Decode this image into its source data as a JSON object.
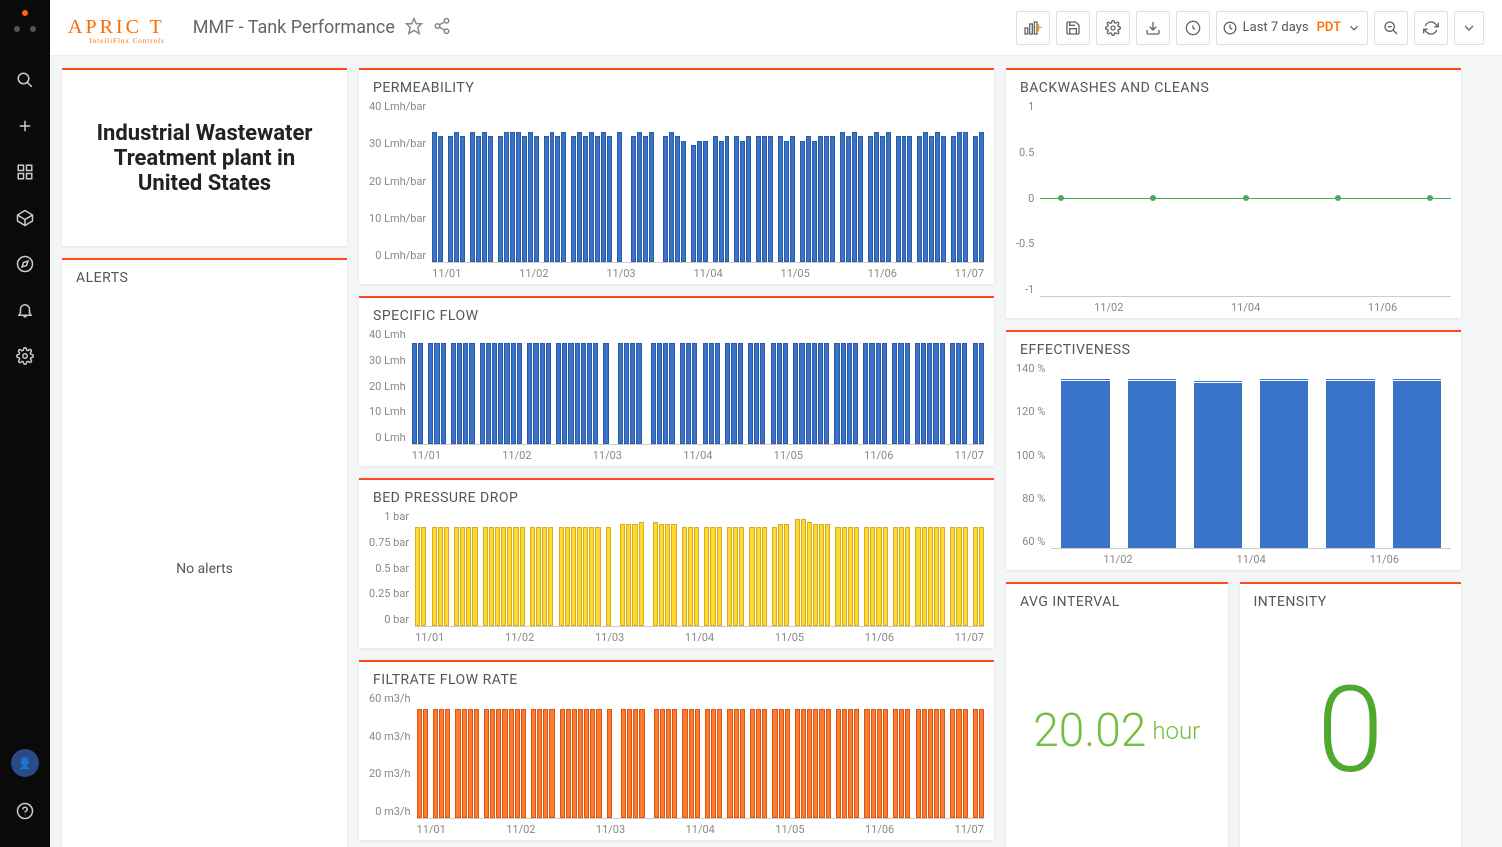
{
  "brand": {
    "name": "APRIC  T",
    "sub": "IntelliFlux Controls"
  },
  "page_title": "MMF - Tank Performance",
  "time_picker": {
    "label": "Last 7 days",
    "tz": "PDT"
  },
  "headline": "Industrial Wastewater Treatment plant in United States",
  "alerts": {
    "title": "ALERTS",
    "empty_text": "No alerts"
  },
  "avg_interval": {
    "title": "AVG INTERVAL",
    "value": "20.02",
    "unit": "hour"
  },
  "intensity": {
    "title": "INTENSITY",
    "value": "0"
  },
  "chart_data": [
    {
      "id": "permeability",
      "title": "PERMEABILITY",
      "type": "bar",
      "ylim": [
        0,
        40
      ],
      "yunit": "Lmh/bar",
      "yticks": [
        0,
        10,
        20,
        30,
        40
      ],
      "color": "blue",
      "categories": [
        "11/01",
        "11/02",
        "11/03",
        "11/04",
        "11/05",
        "11/06",
        "11/07"
      ],
      "values": [
        32,
        31,
        0,
        31,
        32,
        31,
        0,
        32,
        31,
        32,
        31,
        0,
        31,
        32,
        32,
        32,
        31,
        32,
        31,
        0,
        31,
        32,
        31,
        32,
        0,
        31,
        32,
        31,
        32,
        31,
        32,
        31,
        0,
        32,
        0,
        0,
        31,
        32,
        31,
        32,
        0,
        0,
        31,
        32,
        31,
        30,
        0,
        29,
        30,
        30,
        0,
        31,
        30,
        31,
        0,
        31,
        30,
        31,
        0,
        31,
        31,
        31,
        0,
        31,
        30,
        31,
        0,
        30,
        31,
        30,
        31,
        31,
        31,
        0,
        32,
        31,
        32,
        31,
        0,
        31,
        32,
        31,
        32,
        0,
        31,
        31,
        31,
        0,
        31,
        32,
        31,
        32,
        31,
        0,
        31,
        32,
        32,
        0,
        31,
        32
      ]
    },
    {
      "id": "specific_flow",
      "title": "SPECIFIC FLOW",
      "type": "bar",
      "ylim": [
        0,
        40
      ],
      "yunit": "Lmh",
      "yticks": [
        0,
        10,
        20,
        30,
        40
      ],
      "color": "blue",
      "categories": [
        "11/01",
        "11/02",
        "11/03",
        "11/04",
        "11/05",
        "11/06",
        "11/07"
      ],
      "values": [
        35,
        35,
        0,
        35,
        35,
        35,
        0,
        35,
        35,
        35,
        35,
        0,
        35,
        35,
        35,
        35,
        35,
        35,
        35,
        0,
        35,
        35,
        35,
        35,
        0,
        35,
        35,
        35,
        35,
        35,
        35,
        35,
        0,
        35,
        0,
        0,
        35,
        35,
        35,
        35,
        0,
        0,
        35,
        35,
        35,
        35,
        0,
        35,
        35,
        35,
        0,
        35,
        35,
        35,
        0,
        35,
        35,
        35,
        0,
        35,
        35,
        35,
        0,
        35,
        35,
        35,
        0,
        35,
        35,
        35,
        35,
        35,
        35,
        0,
        35,
        35,
        35,
        35,
        0,
        35,
        35,
        35,
        35,
        0,
        35,
        35,
        35,
        0,
        35,
        35,
        35,
        35,
        35,
        0,
        35,
        35,
        35,
        0,
        35,
        35
      ]
    },
    {
      "id": "bed_pressure_drop",
      "title": "BED PRESSURE DROP",
      "type": "bar",
      "ylim": [
        0,
        1.0
      ],
      "yunit": "bar",
      "yticks": [
        0,
        0.25,
        0.5,
        0.75,
        1.0
      ],
      "color": "yellow",
      "categories": [
        "11/01",
        "11/02",
        "11/03",
        "11/04",
        "11/05",
        "11/06",
        "11/07"
      ],
      "values": [
        0.85,
        0.85,
        0,
        0.85,
        0.85,
        0.85,
        0,
        0.85,
        0.85,
        0.85,
        0.85,
        0,
        0.85,
        0.85,
        0.85,
        0.85,
        0.85,
        0.85,
        0.85,
        0,
        0.85,
        0.85,
        0.85,
        0.85,
        0,
        0.85,
        0.85,
        0.85,
        0.85,
        0.85,
        0.85,
        0.85,
        0,
        0.85,
        0,
        0,
        0.88,
        0.88,
        0.88,
        0.9,
        0,
        0,
        0.9,
        0.88,
        0.88,
        0.88,
        0,
        0.85,
        0.85,
        0.85,
        0,
        0.85,
        0.85,
        0.85,
        0,
        0.85,
        0.85,
        0.85,
        0,
        0.85,
        0.85,
        0.85,
        0,
        0.85,
        0.88,
        0.88,
        0,
        0.92,
        0.92,
        0.9,
        0.88,
        0.88,
        0.88,
        0,
        0.85,
        0.85,
        0.85,
        0.85,
        0,
        0.85,
        0.85,
        0.85,
        0.85,
        0,
        0.85,
        0.85,
        0.85,
        0,
        0.85,
        0.85,
        0.85,
        0.85,
        0.85,
        0,
        0.85,
        0.85,
        0.85,
        0,
        0.85,
        0.85
      ]
    },
    {
      "id": "filtrate_flow_rate",
      "title": "FILTRATE FLOW RATE",
      "type": "bar",
      "ylim": [
        0,
        60
      ],
      "yunit": "m3/h",
      "yticks": [
        0,
        20,
        40,
        60
      ],
      "color": "orange",
      "categories": [
        "11/01",
        "11/02",
        "11/03",
        "11/04",
        "11/05",
        "11/06",
        "11/07"
      ],
      "values": [
        52,
        52,
        0,
        52,
        52,
        52,
        0,
        52,
        52,
        52,
        52,
        0,
        52,
        52,
        52,
        52,
        52,
        52,
        52,
        0,
        52,
        52,
        52,
        52,
        0,
        52,
        52,
        52,
        52,
        52,
        52,
        52,
        0,
        52,
        0,
        0,
        52,
        52,
        52,
        52,
        0,
        0,
        52,
        52,
        52,
        52,
        0,
        52,
        52,
        52,
        0,
        52,
        52,
        52,
        0,
        52,
        52,
        52,
        0,
        52,
        52,
        52,
        0,
        52,
        52,
        52,
        0,
        52,
        52,
        52,
        52,
        52,
        52,
        0,
        52,
        52,
        52,
        52,
        0,
        52,
        52,
        52,
        52,
        0,
        52,
        52,
        52,
        0,
        52,
        52,
        52,
        52,
        52,
        0,
        52,
        52,
        52,
        0,
        52,
        52
      ]
    },
    {
      "id": "backwashes_cleans",
      "title": "BACKWASHES AND CLEANS",
      "type": "line",
      "ylim": [
        -1.0,
        1.0
      ],
      "yticks": [
        -1.0,
        -0.5,
        0,
        0.5,
        1.0
      ],
      "color": "green",
      "categories": [
        "11/02",
        "11/04",
        "11/06"
      ],
      "x_points_count": 5,
      "values": [
        0,
        0,
        0,
        0,
        0
      ]
    },
    {
      "id": "effectiveness",
      "title": "EFFECTIVENESS",
      "type": "bar",
      "ylim": [
        50,
        140
      ],
      "yunit": "%",
      "yticks": [
        60,
        80,
        100,
        120,
        140
      ],
      "color": "blue",
      "categories": [
        "11/02",
        "11/04",
        "11/06"
      ],
      "series": [
        {
          "name": "val",
          "values": [
            131,
            131,
            130,
            131,
            131,
            131
          ]
        },
        {
          "name": "line_overlay",
          "values": [
            132,
            131,
            131,
            131,
            132,
            131
          ]
        }
      ]
    }
  ]
}
